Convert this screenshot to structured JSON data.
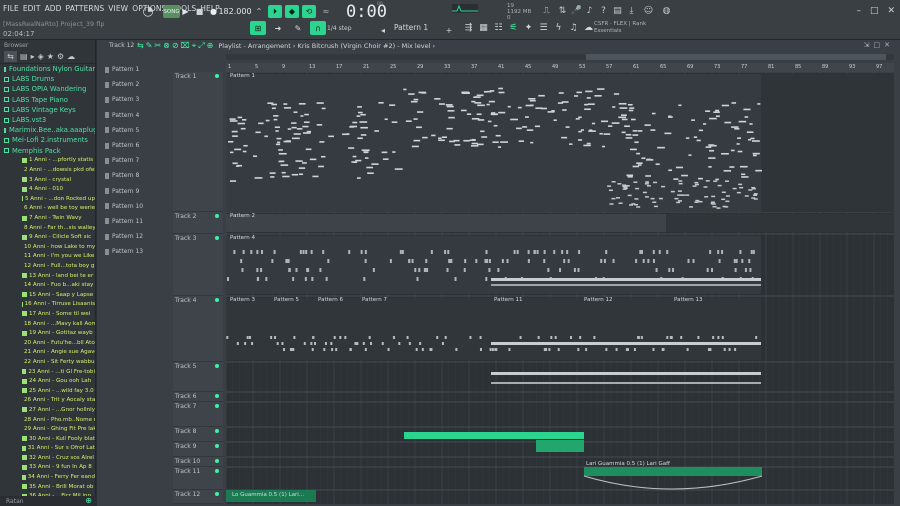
{
  "menu": [
    "FILE",
    "EDIT",
    "ADD",
    "PATTERNS",
    "VIEW",
    "OPTIONS",
    "TOOLS",
    "HELP"
  ],
  "hint": "[MassRealNaRto] Project_39 flp",
  "time_small": "02:04:17",
  "transport": {
    "pat_song": "SONG",
    "tempo": "182.000"
  },
  "clock": {
    "main": "0:00",
    "sub": "00"
  },
  "cpu": {
    "line1": "19",
    "line2": "1192 MB",
    "line3": "0"
  },
  "step": "1/4 step",
  "pattern_selector": "Pattern 1",
  "brow_title": {
    "line1": "CSFR · FLEX | Rank",
    "line2": "Essentials"
  },
  "browser": {
    "header": "Browser",
    "footer": "Ratan",
    "folders": [
      "Foundations Nylon Guitar",
      "LABS Drums",
      "LABS OPIA Wandering",
      "LABS Tape Piano",
      "LABS Vintage Keys",
      "LABS.vst3",
      "Marimix.Bee..aka.aaaplugin",
      "Mei-Lofi 2.instruments",
      "Memphis Pack"
    ],
    "items": [
      "1 Anni - ...pfortly statis",
      "2 Anni - ...dowsis pkd ofer",
      "3 Anni - crystal",
      "4 Anni - 010",
      "5 Anni - ...don Rocked up",
      "6 Anni - well be toy weriers",
      "7 Anni - Twin Wavy",
      "8 Anni - Far th...sis walley st",
      "9 Anni - Cilicle Soft sic",
      "10 Anni - how Lake to my Mocks",
      "11 Anni - I'm you we Like 13",
      "12 Anni - Full...tota boy gilex",
      "13 Anni - land bei te er",
      "14 Anni - Fuo b...aki stay sh",
      "15 Anni - Saap y Lapse",
      "16 Anni - Tirruse Lisaanis",
      "17 Anni - Some til wei",
      "18 Anni - ...Mavy kall Aoma",
      "19 Anni - Gotitaz wayb",
      "20 Anni - Futu'he...bll Atonis",
      "21 Anni - Angie sue Agavo",
      "22 Anni - Sit Ferty wabbuiny",
      "23 Anni - ...ti Gl Fre-tobi",
      "24 Anni - Gou ooh Lah",
      "25 Anni - ...wild fay 3.0",
      "26 Anni - Trit y Aocaly stan",
      "27 Anni - ...Gnor hollnly",
      "28 Anni - Pho.mb..Nome mmes",
      "29 Anni - Ghing Fit Pre lake",
      "30 Anni - Kull Fooly blat",
      "31 Anni - Sur s Ofrof Lat",
      "32 Anni - Cruz sos Alrel",
      "33 Anni - 9 fun In Ap 8",
      "34 Anni - Ferry Fer eand",
      "35 Anni - Brill Morat ob",
      "36 Anni - ...Ficr Mil ino"
    ]
  },
  "playlist": {
    "title": "Playlist - Arrangement › Kris Bitcrush (Virgin Choir #2) - Mix level ›",
    "track_label_top": "Track 12",
    "patterns": [
      "Pattern 1",
      "Pattern 2",
      "Pattern 3",
      "Pattern 4",
      "Pattern 5",
      "Pattern 6",
      "Pattern 7",
      "Pattern 8",
      "Pattern 9",
      "Pattern 10",
      "Pattern 11",
      "Pattern 12",
      "Pattern 13"
    ],
    "tracks": [
      {
        "label": "Track 1"
      },
      {
        "label": "Track 2"
      },
      {
        "label": "Track 3"
      },
      {
        "label": "Track 4"
      },
      {
        "label": "Track 5"
      },
      {
        "label": "Track 6"
      },
      {
        "label": "Track 7"
      },
      {
        "label": "Track 8"
      },
      {
        "label": "Track 9"
      },
      {
        "label": "Track 10"
      },
      {
        "label": "Track 11"
      },
      {
        "label": "Track 12"
      }
    ],
    "ruler": [
      "1",
      "5",
      "9",
      "13",
      "17",
      "21",
      "25",
      "29",
      "33",
      "37",
      "41",
      "45",
      "49",
      "53",
      "57",
      "61",
      "65",
      "69",
      "73",
      "77",
      "81",
      "85",
      "89",
      "93",
      "97"
    ],
    "clips": [
      {
        "label": "Pattern 1"
      },
      {
        "label": "Pattern 2"
      },
      {
        "label": "Pattern 4"
      },
      {
        "label": "Pattern 3"
      },
      {
        "label": "Pattern 5"
      },
      {
        "label": "Pattern 6"
      },
      {
        "label": "Pattern 7"
      },
      {
        "label": "Pattern 11"
      },
      {
        "label": "Pattern 12"
      },
      {
        "label": "Pattern 13"
      },
      {
        "label": "Lari Guammia 0.5 (1) Lari Gaff"
      },
      {
        "label": "Lo Guammia 0.5 (1) Lari..."
      }
    ]
  },
  "colors": {
    "accent": "#2bd48f",
    "folder": "#4fe0a2",
    "item": "#d8f06a",
    "bg": "#2c3136"
  }
}
